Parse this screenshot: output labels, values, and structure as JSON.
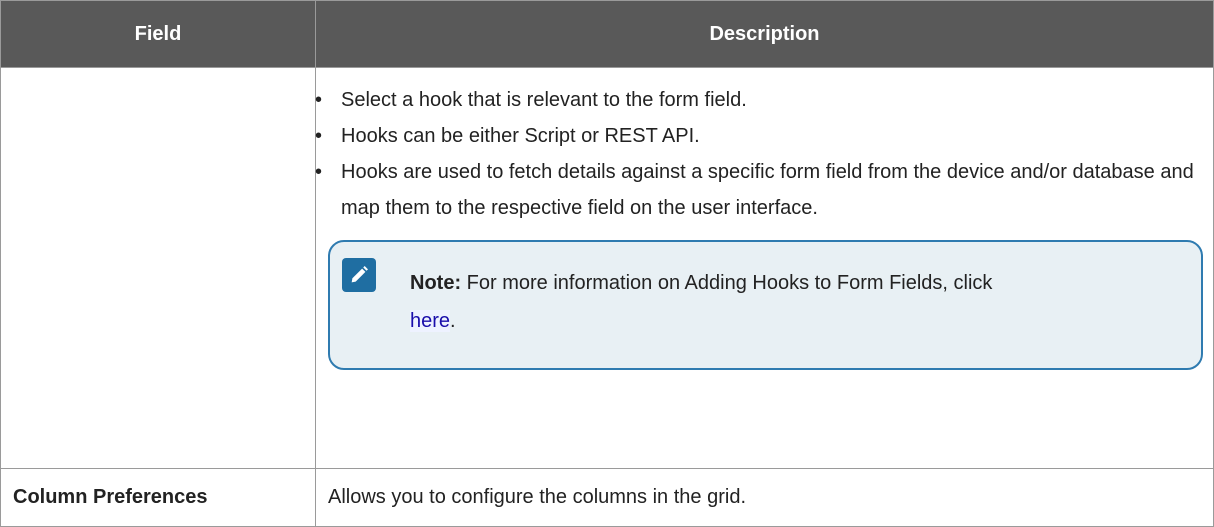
{
  "table": {
    "headers": [
      "Field",
      "Description"
    ],
    "hooks_row": {
      "field": "",
      "bullets": [
        "Select a hook that is relevant to the form field.",
        "Hooks can be either Script or REST API.",
        "Hooks are used to fetch details against a specific form field from the device and/or database and map them to the respective field on the user interface."
      ],
      "note": {
        "icon": "pencil-icon",
        "label": "Note:",
        "text": "For more information on Adding Hooks to Form Fields, click",
        "link_text": "here",
        "suffix": "."
      }
    },
    "column_preferences_row": {
      "field": "Column Preferences",
      "description": "Allows you to configure the columns in the grid."
    }
  },
  "colors": {
    "header_bg": "#595959",
    "note_bg": "#e8f0f4",
    "note_border": "#2f7bb0",
    "link": "#1a0dab"
  }
}
